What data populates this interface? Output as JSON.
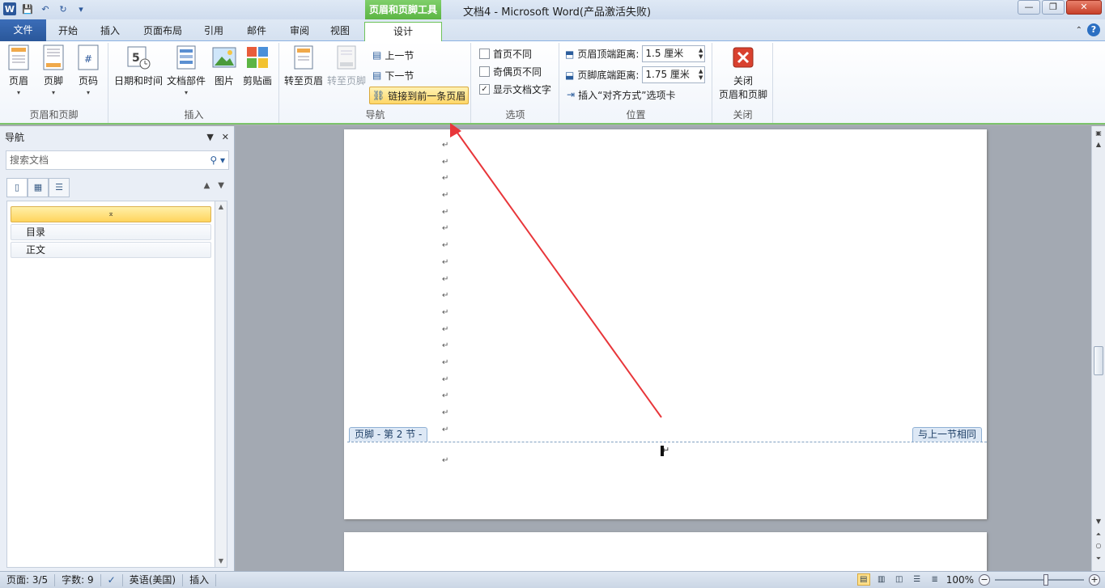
{
  "window": {
    "title": "文档4 - Microsoft Word(产品激活失败)",
    "context_tab_title": "页眉和页脚工具",
    "controls": [
      "—",
      "❐",
      "✕"
    ]
  },
  "qat": {
    "save": "💾",
    "undo": "↶",
    "redo": "↻",
    "more": "▾",
    "logo": "W"
  },
  "tabs": {
    "file": "文件",
    "items": [
      "开始",
      "插入",
      "页面布局",
      "引用",
      "邮件",
      "审阅",
      "视图"
    ],
    "active": "设计"
  },
  "ribbon": {
    "header_footer": {
      "label": "页眉和页脚",
      "buttons": [
        "页眉",
        "页脚",
        "页码"
      ]
    },
    "insert": {
      "label": "插入",
      "buttons": [
        "日期和时间",
        "文档部件",
        "图片",
        "剪贴画"
      ]
    },
    "navigation": {
      "label": "导航",
      "goto_header": "转至页眉",
      "goto_footer": "转至页脚",
      "prev_section": "上一节",
      "next_section": "下一节",
      "link_previous": "链接到前一条页眉"
    },
    "options": {
      "label": "选项",
      "different_first": "首页不同",
      "different_odd_even": "奇偶页不同",
      "show_doc_text": "显示文档文字",
      "show_doc_text_checked": true
    },
    "position": {
      "label": "位置",
      "header_top_label": "页眉顶端距离:",
      "header_top_value": "1.5 厘米",
      "footer_bottom_label": "页脚底端距离:",
      "footer_bottom_value": "1.75 厘米",
      "insert_align_tab": "插入“对齐方式”选项卡"
    },
    "close": {
      "label": "关闭",
      "button_line1": "关闭",
      "button_line2": "页眉和页脚"
    }
  },
  "nav_pane": {
    "title": "导航",
    "search_placeholder": "搜索文档",
    "items": [
      "目录",
      "正文"
    ],
    "selected_glyph": "⌅"
  },
  "document": {
    "footer_tag_left": "页脚 - 第 2 节 -",
    "footer_tag_right": "与上一节相同",
    "para_mark": "↵"
  },
  "status_bar": {
    "page": "页面: 3/5",
    "words": "字数: 9",
    "language": "英语(美国)",
    "mode": "插入",
    "zoom": "100%"
  },
  "colors": {
    "accent_green": "#5cb544",
    "file_tab_blue": "#2a579a",
    "arrow_red": "#e8363a"
  }
}
